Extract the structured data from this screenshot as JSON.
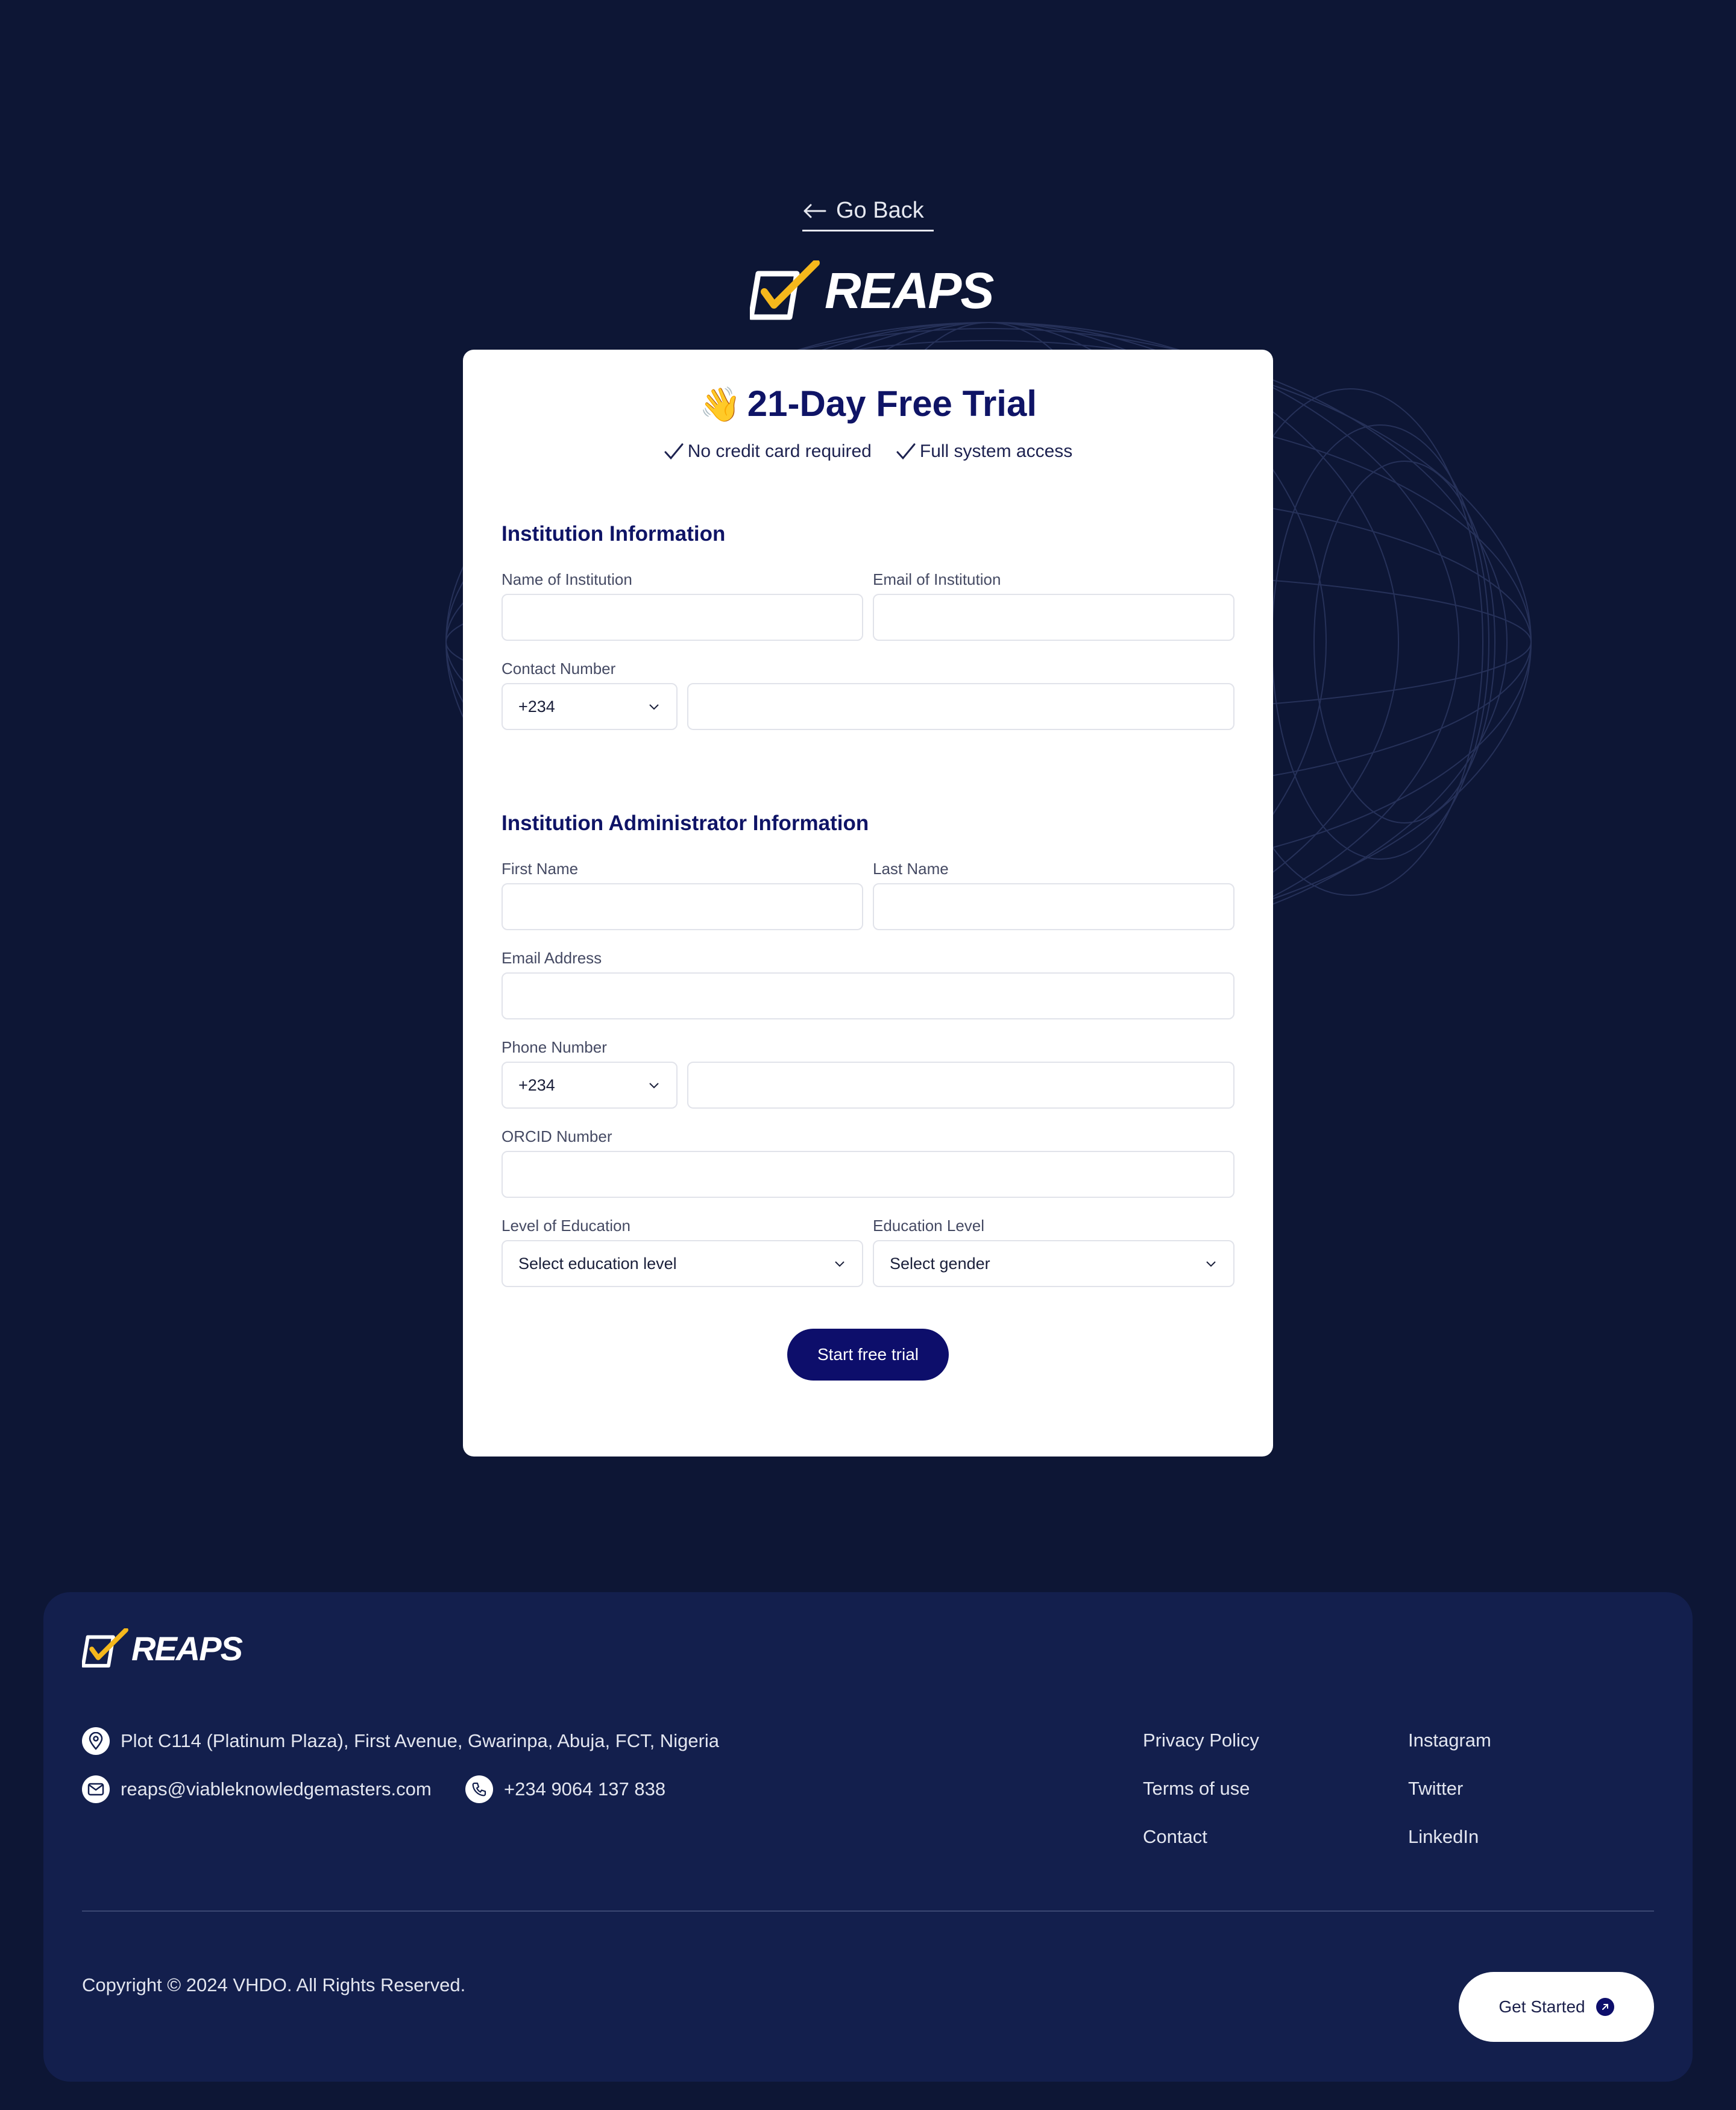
{
  "nav": {
    "go_back": "Go Back",
    "back_icon": "arrow-left-icon"
  },
  "brand": {
    "name": "REAPS",
    "accent": "#f5b81c"
  },
  "card": {
    "title": "21-Day Free Trial",
    "title_emoji": "👋",
    "features": [
      "No credit card required",
      "Full system access"
    ],
    "institution_section": {
      "title": "Institution Information",
      "name_label": "Name of Institution",
      "name_value": "",
      "email_label": "Email of Institution",
      "email_value": "",
      "contact_label": "Contact Number",
      "contact_code": "+234",
      "contact_value": ""
    },
    "admin_section": {
      "title": "Institution Administrator Information",
      "first_name_label": "First Name",
      "first_name_value": "",
      "last_name_label": "Last Name",
      "last_name_value": "",
      "email_label": "Email Address",
      "email_value": "",
      "phone_label": "Phone Number",
      "phone_code": "+234",
      "phone_value": "",
      "orcid_label": "ORCID Number",
      "orcid_value": "",
      "level_label": "Level of Education",
      "level_value": "Select education level",
      "edu_label": "Education Level",
      "edu_value": "Select gender"
    },
    "submit_label": "Start free trial"
  },
  "footer": {
    "address": "Plot C114 (Platinum Plaza), First Avenue, Gwarinpa, Abuja, FCT, Nigeria",
    "email": "reaps@viableknowledgemasters.com",
    "phone": "+234 9064 137 838",
    "links_col1": [
      "Privacy Policy",
      "Terms of use",
      "Contact"
    ],
    "links_col2": [
      "Instagram",
      "Twitter",
      "LinkedIn"
    ],
    "copyright": "Copyright © 2024 VHDO. All Rights Reserved.",
    "cta": "Get Started"
  },
  "colors": {
    "background": "#0d1635",
    "footer_bg": "#131f4d",
    "primary": "#0d0e6b",
    "card_title": "#0f1466"
  }
}
